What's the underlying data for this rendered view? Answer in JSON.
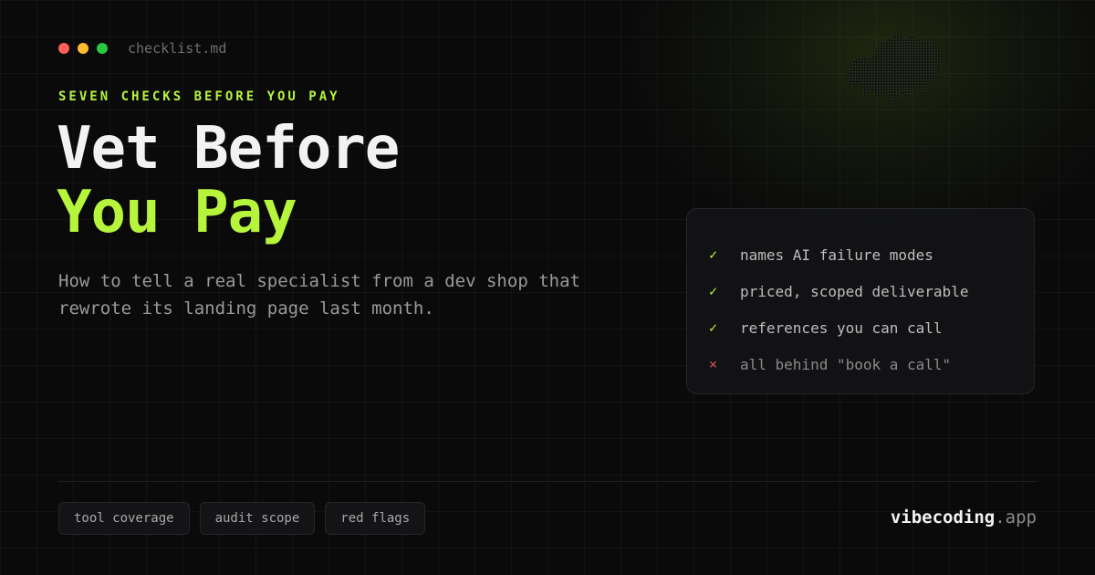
{
  "colors": {
    "background": "#0a0a0b",
    "accent": "#b7f53c",
    "close": "#ff5f57",
    "minimize": "#febc2e",
    "maximize": "#28c840",
    "negative": "#d9534f"
  },
  "window": {
    "filename": "checklist.md"
  },
  "hero": {
    "eyebrow": "SEVEN CHECKS BEFORE YOU PAY",
    "title_line1": "Vet Before",
    "title_line2": "You Pay",
    "subtitle_line1": "How to tell a real specialist from a dev shop that",
    "subtitle_line2": "rewrote its landing page last month."
  },
  "checklist": {
    "items": [
      {
        "mark": "✓",
        "text": "names AI failure modes",
        "status": "good"
      },
      {
        "mark": "✓",
        "text": "priced, scoped deliverable",
        "status": "good"
      },
      {
        "mark": "✓",
        "text": "references you can call",
        "status": "good"
      },
      {
        "mark": "×",
        "text": "all behind \"book a call\"",
        "status": "bad"
      }
    ]
  },
  "tags": [
    "tool coverage",
    "audit scope",
    "red flags"
  ],
  "brand": {
    "name": "vibecoding",
    "tld": ".app"
  }
}
